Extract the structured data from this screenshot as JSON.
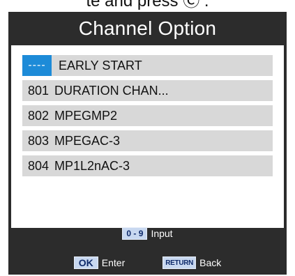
{
  "top_caption": "te and press Ⓒ .",
  "window": {
    "title": "Channel Option"
  },
  "channels": [
    {
      "number": "----",
      "name": "EARLY START",
      "selected": true
    },
    {
      "number": "801",
      "name": "DURATION CHAN...",
      "selected": false
    },
    {
      "number": "802",
      "name": "MPEGMP2",
      "selected": false
    },
    {
      "number": "803",
      "name": "MPEGAC-3",
      "selected": false
    },
    {
      "number": "804",
      "name": "MP1L2nAC-3",
      "selected": false
    }
  ],
  "footer": {
    "input_key": "0 - 9",
    "input_label": "Input",
    "ok_key": "OK",
    "ok_label": "Enter",
    "return_key": "RETURN",
    "return_label": "Back"
  },
  "colors": {
    "panel_bg": "#2c2c2c",
    "row_bg": "#d8d8d8",
    "selected": "#1d8bd8",
    "key_bg": "#c8d8f0"
  }
}
